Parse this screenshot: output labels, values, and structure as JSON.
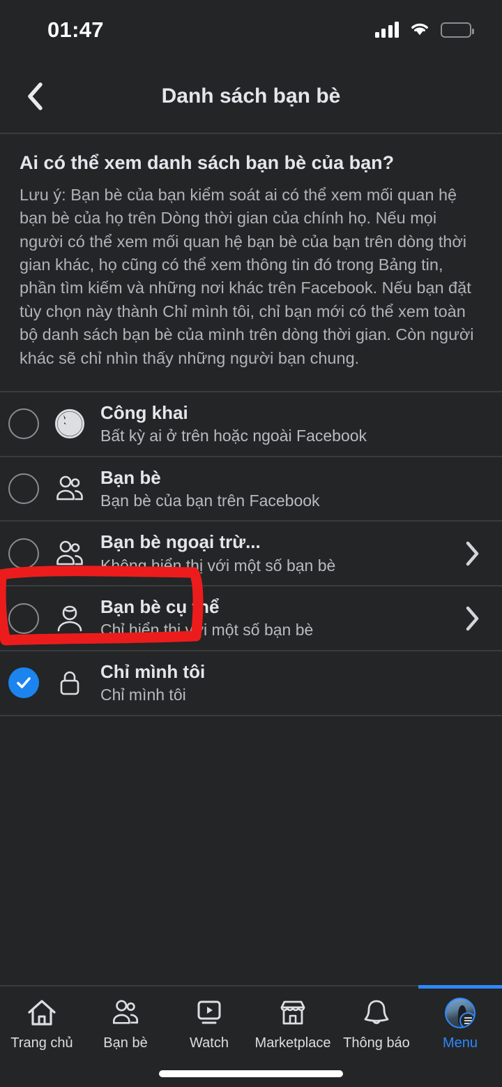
{
  "status_bar": {
    "time": "01:47",
    "signal_icon": "cellular-signal-icon",
    "wifi_icon": "wifi-icon",
    "battery_icon": "battery-low-icon",
    "battery_color": "#f5cb11"
  },
  "header": {
    "back_icon": "chevron-left-icon",
    "title": "Danh sách bạn bè"
  },
  "description": {
    "title": "Ai có thể xem danh sách bạn bè của bạn?",
    "body": "Lưu ý: Bạn bè của bạn kiểm soát ai có thể xem mối quan hệ bạn bè của họ trên Dòng thời gian của chính họ. Nếu mọi người có thể xem mối quan hệ bạn bè của bạn trên dòng thời gian khác, họ cũng có thể xem thông tin đó trong Bảng tin, phần tìm kiếm và những nơi khác trên Facebook. Nếu bạn đặt tùy chọn này thành Chỉ mình tôi, chỉ bạn mới có thể xem toàn bộ danh sách bạn bè của mình trên dòng thời gian. Còn người khác sẽ chỉ nhìn thấy những người bạn chung."
  },
  "options": [
    {
      "title": "Công khai",
      "subtitle": "Bất kỳ ai ở trên hoặc ngoài Facebook",
      "icon": "globe-icon",
      "selected": false,
      "has_chevron": false
    },
    {
      "title": "Bạn bè",
      "subtitle": "Bạn bè của bạn trên Facebook",
      "icon": "friends-icon",
      "selected": false,
      "has_chevron": false
    },
    {
      "title": "Bạn bè ngoại trừ...",
      "subtitle": "Không hiển thị với một số bạn bè",
      "icon": "friends-icon",
      "selected": false,
      "has_chevron": true
    },
    {
      "title": "Bạn bè cụ thể",
      "subtitle": "Chỉ hiển thị với một số bạn bè",
      "icon": "person-icon",
      "selected": false,
      "has_chevron": true
    },
    {
      "title": "Chỉ mình tôi",
      "subtitle": "Chỉ mình tôi",
      "icon": "lock-icon",
      "selected": true,
      "has_chevron": false
    }
  ],
  "annotation": {
    "shape": "hand-drawn-rectangle",
    "color": "#ec1c1c",
    "target": "Chỉ mình tôi"
  },
  "tabbar": {
    "active_index": 5,
    "accent_color": "#2d88ff",
    "items": [
      {
        "label": "Trang chủ",
        "icon": "home-icon"
      },
      {
        "label": "Bạn bè",
        "icon": "friends-icon"
      },
      {
        "label": "Watch",
        "icon": "watch-play-icon"
      },
      {
        "label": "Marketplace",
        "icon": "marketplace-store-icon"
      },
      {
        "label": "Thông báo",
        "icon": "bell-icon"
      },
      {
        "label": "Menu",
        "icon": "avatar-menu-icon"
      }
    ]
  }
}
